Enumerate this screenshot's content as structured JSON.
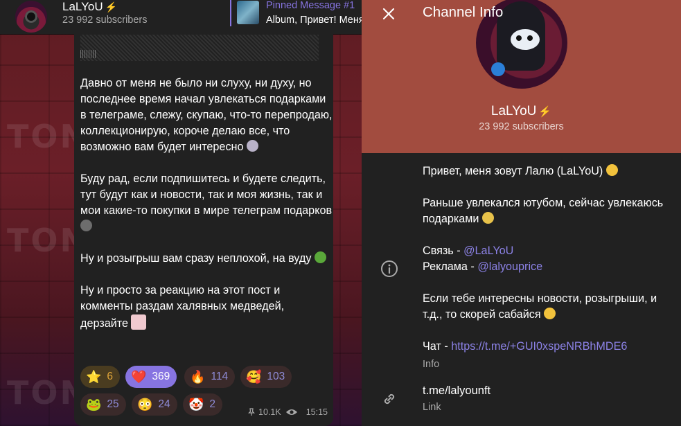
{
  "chat": {
    "channel_name": "LaLYoU",
    "subscribers": "23 992 subscribers",
    "pinned": {
      "title": "Pinned Message #1",
      "text": "Album, Привет! Меня"
    },
    "background_word": "TON",
    "post": {
      "paragraphs": [
        "Давно от меня не было ни слуху, ни духу, но последнее время начал увлекаться подарками в телеграме, слежу, скупаю, что-то перепродаю, коллекционирую, короче делаю все, что возможно вам будет интересно",
        "Буду рад, если подпишитесь и будете следить, тут будут как и новости, так и моя жизнь, так и мои какие-то покупки в мире телеграм подарков",
        "Ну и розыгрыш вам сразу неплохой, на вуду",
        "Ну и просто за реакцию на этот пост и комменты раздам халявных медведей, дерзайте"
      ],
      "reactions": [
        {
          "icon": "star-icon",
          "glyph": "⭐",
          "count": "6"
        },
        {
          "icon": "heart-icon",
          "glyph": "❤️",
          "count": "369"
        },
        {
          "icon": "fire-icon",
          "glyph": "🔥",
          "count": "114"
        },
        {
          "icon": "smiling-hearts-icon",
          "glyph": "🥰",
          "count": "103"
        },
        {
          "icon": "frog-icon",
          "glyph": "🐸",
          "count": "25"
        },
        {
          "icon": "flushed-face-icon",
          "glyph": "😳",
          "count": "24"
        },
        {
          "icon": "clown-icon",
          "glyph": "🤡",
          "count": "2"
        }
      ],
      "views": "10.1K",
      "time": "15:15"
    }
  },
  "info": {
    "title": "Channel Info",
    "name": "LaLYoU",
    "subscribers": "23 992 subscribers",
    "description": {
      "line1": "Привет, меня зовут Лалю (LaLYoU)",
      "line2": "Раньше увлекался ютубом, сейчас увлекаюсь подарками",
      "contact_label": "Связь - ",
      "contact_value": "@LaLYoU",
      "ads_label": "Реклама - ",
      "ads_value": "@lalyouprice",
      "line5": "Если тебе интересны новости, розыгрыши, и т.д., то скорей сабайся",
      "chat_label": "Чат - ",
      "chat_value": "https://t.me/+GUI0xspeNRBhMDE6"
    },
    "description_label": "Info",
    "link_value": "t.me/lalyounft",
    "link_label": "Link"
  },
  "colors": {
    "accent": "#8774e1",
    "hero_background": "#a24c3f",
    "badge_red": "#e8453c"
  }
}
